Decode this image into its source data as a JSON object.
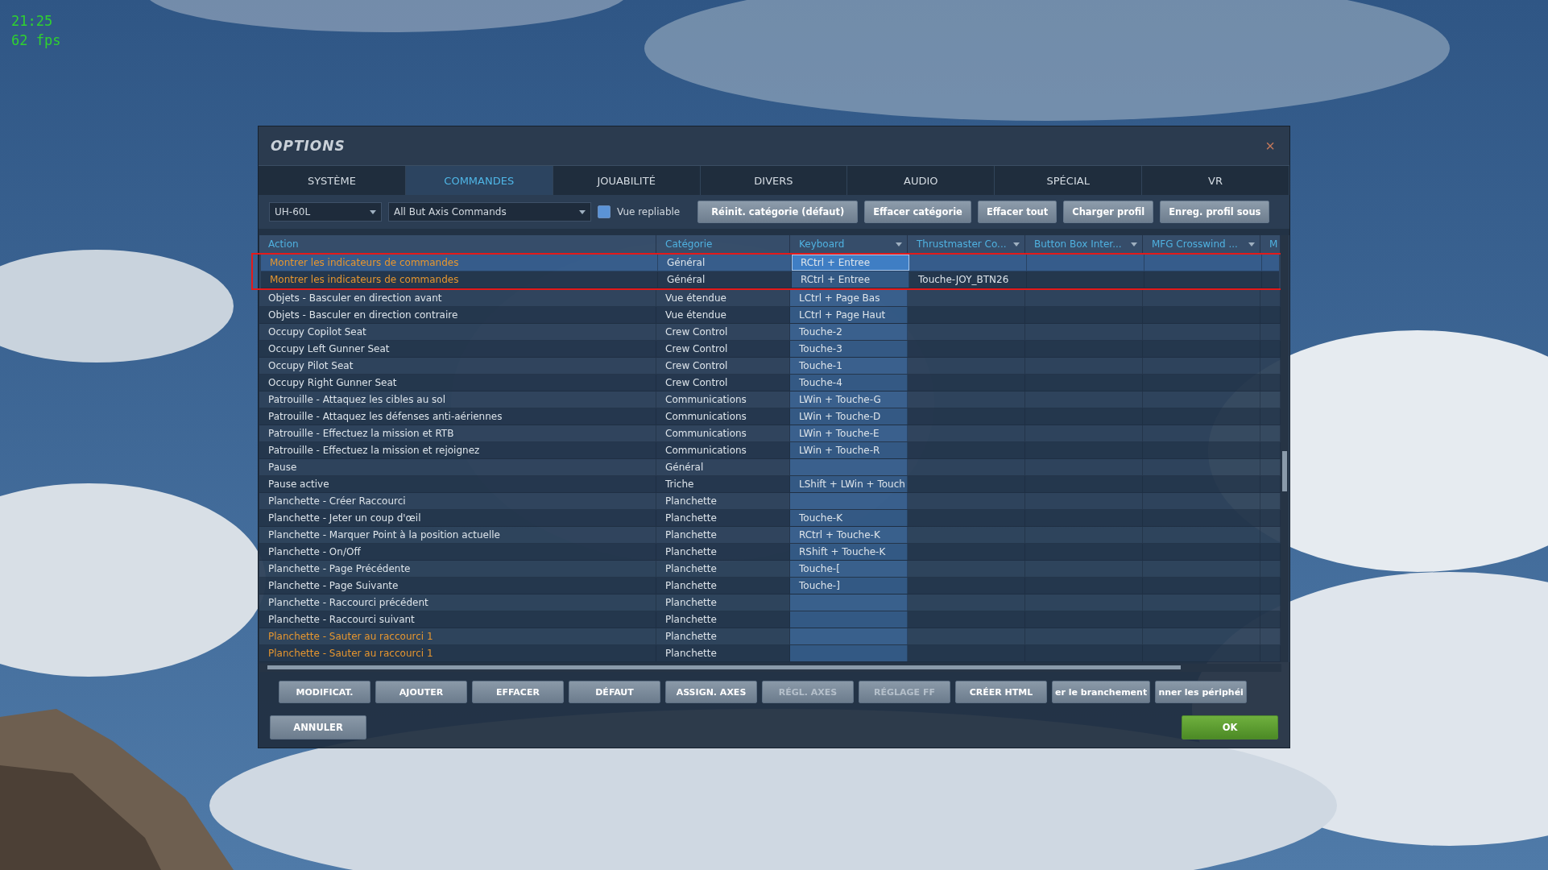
{
  "overlay": {
    "time": "21:25",
    "fps": "62 fps"
  },
  "window": {
    "title": "OPTIONS",
    "close": "×"
  },
  "tabs": [
    {
      "label": "SYSTÈME",
      "selected": false
    },
    {
      "label": "COMMANDES",
      "selected": true
    },
    {
      "label": "JOUABILITÉ",
      "selected": false
    },
    {
      "label": "DIVERS",
      "selected": false
    },
    {
      "label": "AUDIO",
      "selected": false
    },
    {
      "label": "SPÉCIAL",
      "selected": false
    },
    {
      "label": "VR",
      "selected": false
    }
  ],
  "toolbar": {
    "aircraft": "UH-60L",
    "filter": "All But Axis Commands",
    "collapsible": {
      "label": "Vue repliable",
      "checked": true
    },
    "buttons": [
      "Réinit. catégorie (défaut)",
      "Effacer catégorie",
      "Effacer tout",
      "Charger profil",
      "Enreg. profil sous"
    ]
  },
  "table": {
    "columns": [
      {
        "label": "Action",
        "dropdown": false
      },
      {
        "label": "Catégorie",
        "dropdown": false
      },
      {
        "label": "Keyboard",
        "dropdown": true
      },
      {
        "label": "Thrustmaster Co...",
        "dropdown": true
      },
      {
        "label": "Button Box Inter...",
        "dropdown": true
      },
      {
        "label": "MFG Crosswind ...",
        "dropdown": true
      },
      {
        "label": "M"
      }
    ],
    "rows": [
      {
        "action": "Montrer les indicateurs de commandes",
        "category": "Général",
        "keyboard": "RCtrl + Entree",
        "highlighted": true,
        "selected": true,
        "framed": true
      },
      {
        "action": "Montrer les indicateurs de commandes",
        "category": "Général",
        "keyboard": "RCtrl + Entree",
        "joystick": "Touche-JOY_BTN26",
        "highlighted": true,
        "selected": false,
        "framed": true
      },
      {
        "action": "Objets - Basculer en direction avant",
        "category": "Vue étendue",
        "keyboard": "LCtrl + Page Bas",
        "highlighted": false,
        "selected": false,
        "framed": false
      },
      {
        "action": "Objets - Basculer en direction contraire",
        "category": "Vue étendue",
        "keyboard": "LCtrl + Page Haut",
        "highlighted": false,
        "selected": false,
        "framed": false
      },
      {
        "action": "Occupy Copilot Seat",
        "category": "Crew Control",
        "keyboard": "Touche-2",
        "highlighted": false,
        "selected": false,
        "framed": false
      },
      {
        "action": "Occupy Left Gunner Seat",
        "category": "Crew Control",
        "keyboard": "Touche-3",
        "highlighted": false,
        "selected": false,
        "framed": false
      },
      {
        "action": "Occupy Pilot Seat",
        "category": "Crew Control",
        "keyboard": "Touche-1",
        "highlighted": false,
        "selected": false,
        "framed": false
      },
      {
        "action": "Occupy Right Gunner Seat",
        "category": "Crew Control",
        "keyboard": "Touche-4",
        "highlighted": false,
        "selected": false,
        "framed": false
      },
      {
        "action": "Patrouille - Attaquez les cibles au sol",
        "category": "Communications",
        "keyboard": "LWin + Touche-G",
        "highlighted": false,
        "selected": false,
        "framed": false
      },
      {
        "action": "Patrouille - Attaquez les défenses anti-aériennes",
        "category": "Communications",
        "keyboard": "LWin + Touche-D",
        "highlighted": false,
        "selected": false,
        "framed": false
      },
      {
        "action": "Patrouille - Effectuez la mission et RTB",
        "category": "Communications",
        "keyboard": "LWin + Touche-E",
        "highlighted": false,
        "selected": false,
        "framed": false
      },
      {
        "action": "Patrouille - Effectuez la mission et rejoignez",
        "category": "Communications",
        "keyboard": "LWin + Touche-R",
        "highlighted": false,
        "selected": false,
        "framed": false
      },
      {
        "action": "Pause",
        "category": "Général",
        "highlighted": false,
        "selected": false,
        "framed": false
      },
      {
        "action": "Pause active",
        "category": "Triche",
        "keyboard": "LShift + LWin + Touch",
        "highlighted": false,
        "selected": false,
        "framed": false
      },
      {
        "action": "Planchette - Créer Raccourci",
        "category": "Planchette",
        "highlighted": false,
        "selected": false,
        "framed": false
      },
      {
        "action": "Planchette - Jeter un coup d'œil",
        "category": "Planchette",
        "keyboard": "Touche-K",
        "highlighted": false,
        "selected": false,
        "framed": false
      },
      {
        "action": "Planchette - Marquer Point à la position actuelle",
        "category": "Planchette",
        "keyboard": "RCtrl + Touche-K",
        "highlighted": false,
        "selected": false,
        "framed": false
      },
      {
        "action": "Planchette - On/Off",
        "category": "Planchette",
        "keyboard": "RShift + Touche-K",
        "highlighted": false,
        "selected": false,
        "framed": false
      },
      {
        "action": "Planchette - Page Précédente",
        "category": "Planchette",
        "keyboard": "Touche-[",
        "highlighted": false,
        "selected": false,
        "framed": false
      },
      {
        "action": "Planchette - Page Suivante",
        "category": "Planchette",
        "keyboard": "Touche-]",
        "highlighted": false,
        "selected": false,
        "framed": false
      },
      {
        "action": "Planchette - Raccourci précédent",
        "category": "Planchette",
        "highlighted": false,
        "selected": false,
        "framed": false
      },
      {
        "action": "Planchette - Raccourci suivant",
        "category": "Planchette",
        "highlighted": false,
        "selected": false,
        "framed": false
      },
      {
        "action": "Planchette - Sauter au raccourci 1",
        "category": "Planchette",
        "highlighted": true,
        "selected": false,
        "framed": false
      },
      {
        "action": "Planchette - Sauter au raccourci 1",
        "category": "Planchette",
        "highlighted": true,
        "selected": false,
        "framed": false
      }
    ]
  },
  "actions": [
    {
      "label": "MODIFICAT.",
      "disabled": false
    },
    {
      "label": "AJOUTER",
      "disabled": false
    },
    {
      "label": "EFFACER",
      "disabled": false
    },
    {
      "label": "DÉFAUT",
      "disabled": false
    },
    {
      "label": "ASSIGN. AXES",
      "disabled": false
    },
    {
      "label": "RÉGL. AXES",
      "disabled": true
    },
    {
      "label": "RÉGLAGE FF",
      "disabled": true
    },
    {
      "label": "CRÉER HTML",
      "disabled": false
    },
    {
      "label": "er le branchement",
      "disabled": false
    },
    {
      "label": "nner les périphéi",
      "disabled": false
    }
  ],
  "footer": {
    "cancel": "ANNULER",
    "ok": "OK"
  }
}
